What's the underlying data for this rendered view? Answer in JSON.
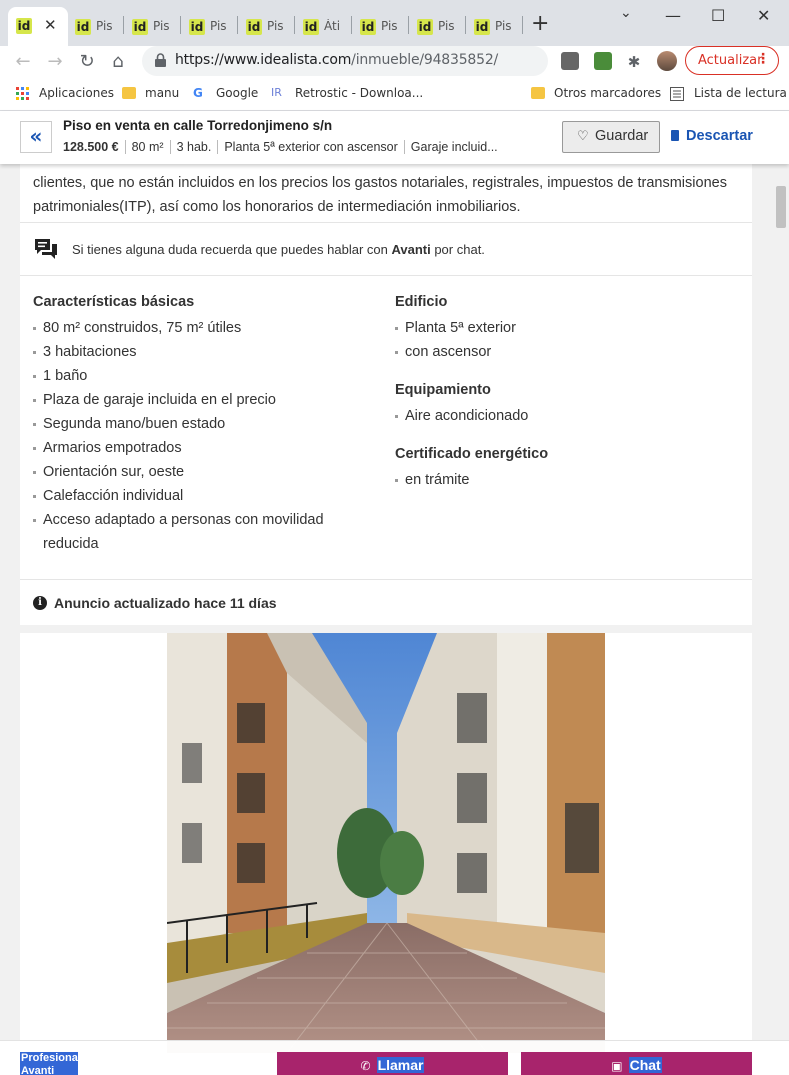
{
  "browser": {
    "tabs": [
      {
        "label": "",
        "active": true
      },
      {
        "label": "Pis"
      },
      {
        "label": "Pis"
      },
      {
        "label": "Pis"
      },
      {
        "label": "Pis"
      },
      {
        "label": "Áti"
      },
      {
        "label": "Pis"
      },
      {
        "label": "Pis"
      },
      {
        "label": "Pis"
      }
    ],
    "favicon_text": "id",
    "close_glyph": "✕",
    "new_tab_glyph": "+",
    "window_controls": {
      "minimize": "—",
      "maximize": "☐",
      "close": "✕"
    },
    "url_host": "https://www.idealista.com",
    "url_path": "/inmueble/94835852/",
    "update_label": "Actualizar",
    "update_menu": "⋮",
    "bookmarks": {
      "apps": "Aplicaciones",
      "manu": "manu",
      "google": "Google",
      "retrostic": "Retrostic - Downloa...",
      "otros": "Otros marcadores",
      "lectura": "Lista de lectura"
    },
    "icons": {
      "back": "arrow-left",
      "forward": "arrow-right",
      "reload": "reload",
      "home": "home"
    }
  },
  "sticky_header": {
    "title": "Piso en venta en calle Torredonjimeno s/n",
    "price": "128.500 €",
    "area": "80 m²",
    "rooms": "3 hab.",
    "floor": "Planta 5ª exterior con ascensor",
    "garage": "Garaje incluid...",
    "save_label": "Guardar",
    "discard_label": "Descartar"
  },
  "description": {
    "text": "clientes, que no están incluidos en los precios los gastos notariales, registrales, impuestos de transmisiones patrimoniales(ITP), así como los honorarios de intermediación inmobiliarios."
  },
  "chat_note": {
    "prefix": "Si tienes alguna duda recuerda que puedes hablar con ",
    "agent": "Avanti",
    "suffix": " por chat."
  },
  "features": {
    "basic_title": "Características básicas",
    "basic": [
      "80 m² construidos, 75 m² útiles",
      "3 habitaciones",
      "1 baño",
      "Plaza de garaje incluida en el precio",
      "Segunda mano/buen estado",
      "Armarios empotrados",
      "Orientación sur, oeste",
      "Calefacción individual",
      "Acceso adaptado a personas con movilidad reducida"
    ],
    "building_title": "Edificio",
    "building": [
      "Planta 5ª exterior",
      "con ascensor"
    ],
    "equipment_title": "Equipamiento",
    "equipment": [
      "Aire acondicionado"
    ],
    "energy_title": "Certificado energético",
    "energy": [
      "en trámite"
    ]
  },
  "updated": "Anuncio actualizado hace 11 días",
  "bottom_bar": {
    "pro_label": "Profesional Avanti",
    "call_label": "Llamar",
    "chat_label": "Chat"
  },
  "colors": {
    "accent_blue": "#1a55b3",
    "cta_magenta": "#a8246c",
    "selection_blue": "#3367d6",
    "favicon_yellow": "#d6e64b"
  }
}
